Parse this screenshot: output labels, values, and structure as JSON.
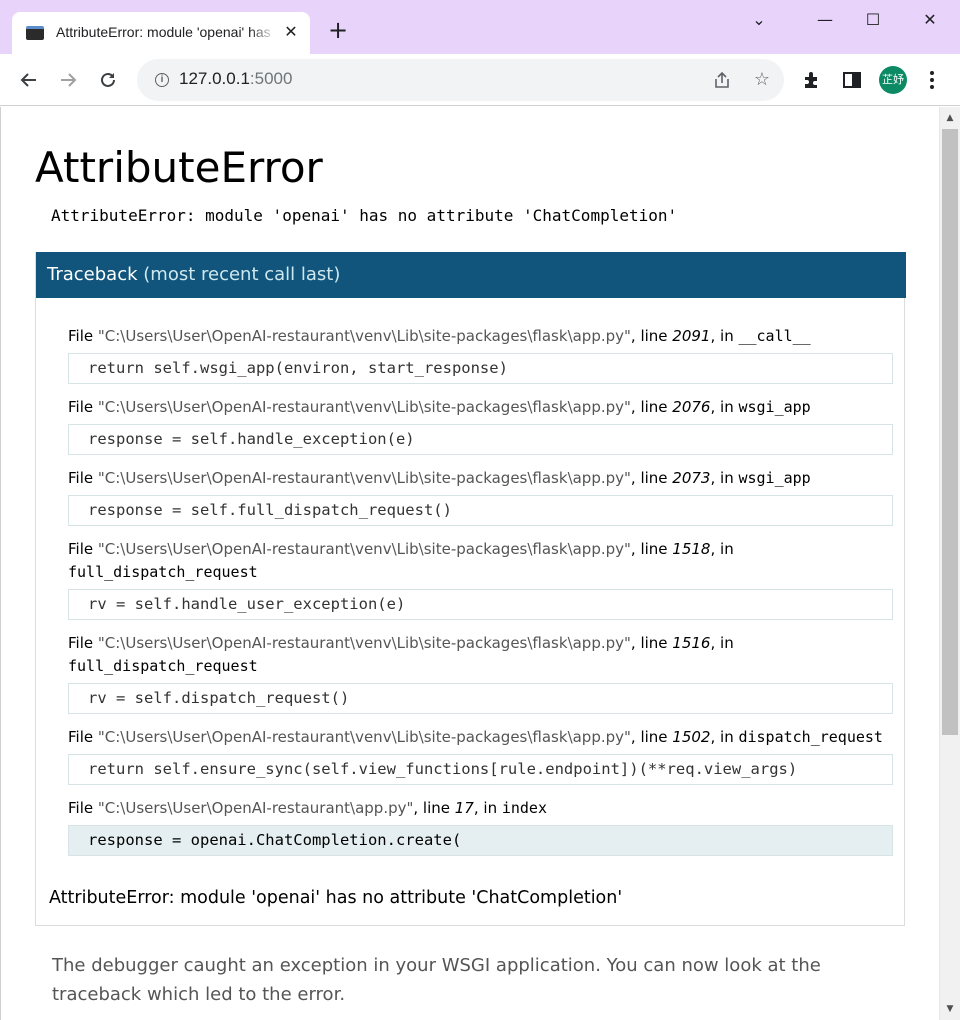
{
  "browser": {
    "tab_title": "AttributeError: module 'openai' has no attribute 'ChatCompletion'",
    "tab_close": "✕",
    "new_tab": "+",
    "window_controls": {
      "dropdown": "⌄",
      "minimize": "—",
      "maximize": "☐",
      "close": "✕"
    },
    "url_host": "127.0.0.1",
    "url_port": ":5000",
    "avatar_text": "芷妤",
    "icons": [
      "back-icon",
      "forward-icon",
      "reload-icon",
      "info-icon",
      "share-icon",
      "star-icon",
      "extensions-icon",
      "sidepanel-icon",
      "menu-icon"
    ]
  },
  "error": {
    "title": "AttributeError",
    "message": "AttributeError: module 'openai' has no attribute 'ChatCompletion'",
    "traceback_label": "Traceback",
    "traceback_sub": "(most recent call last)",
    "final": "AttributeError: module 'openai' has no attribute 'ChatCompletion'"
  },
  "frames": [
    {
      "file": "\"C:\\Users\\User\\OpenAI-restaurant\\venv\\Lib\\site-packages\\flask\\app.py\"",
      "line": "2091",
      "func": "__call__",
      "code": "return self.wsgi_app(environ, start_response)"
    },
    {
      "file": "\"C:\\Users\\User\\OpenAI-restaurant\\venv\\Lib\\site-packages\\flask\\app.py\"",
      "line": "2076",
      "func": "wsgi_app",
      "code": "response = self.handle_exception(e)"
    },
    {
      "file": "\"C:\\Users\\User\\OpenAI-restaurant\\venv\\Lib\\site-packages\\flask\\app.py\"",
      "line": "2073",
      "func": "wsgi_app",
      "code": "response = self.full_dispatch_request()"
    },
    {
      "file": "\"C:\\Users\\User\\OpenAI-restaurant\\venv\\Lib\\site-packages\\flask\\app.py\"",
      "line": "1518",
      "func": "full_dispatch_request",
      "code": "rv = self.handle_user_exception(e)"
    },
    {
      "file": "\"C:\\Users\\User\\OpenAI-restaurant\\venv\\Lib\\site-packages\\flask\\app.py\"",
      "line": "1516",
      "func": "full_dispatch_request",
      "code": "rv = self.dispatch_request()"
    },
    {
      "file": "\"C:\\Users\\User\\OpenAI-restaurant\\venv\\Lib\\site-packages\\flask\\app.py\"",
      "line": "1502",
      "func": "dispatch_request",
      "code": "return self.ensure_sync(self.view_functions[rule.endpoint])(**req.view_args)"
    },
    {
      "file": "\"C:\\Users\\User\\OpenAI-restaurant\\app.py\"",
      "line": "17",
      "func": "index",
      "code": "response = openai.ChatCompletion.create("
    }
  ],
  "frame_words": {
    "file": "File ",
    "line": ", line ",
    "in": ", in "
  },
  "footer": {
    "note": "The debugger caught an exception in your WSGI application. You can now look at the traceback which led to the error."
  }
}
